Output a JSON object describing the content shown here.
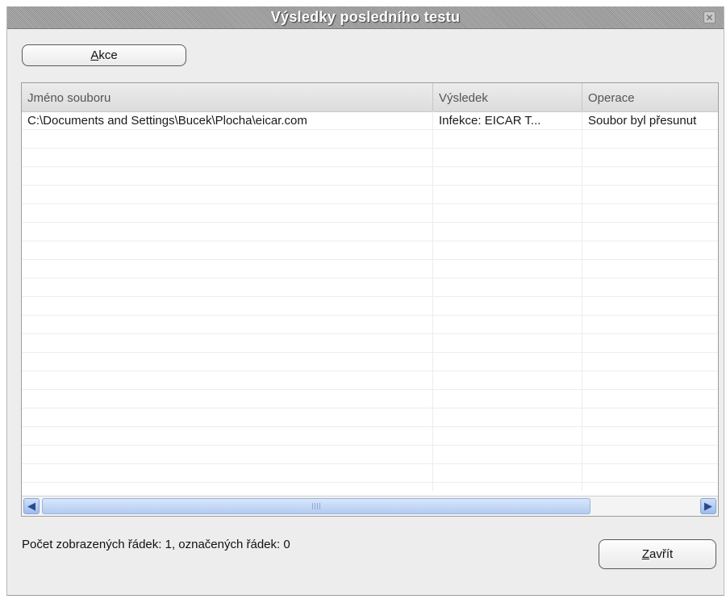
{
  "window": {
    "title": "Výsledky posledního testu",
    "close_glyph": "✕"
  },
  "toolbar": {
    "akce_label_accel": "A",
    "akce_label_rest": "kce"
  },
  "table": {
    "columns": [
      {
        "label": "Jméno souboru"
      },
      {
        "label": "Výsledek"
      },
      {
        "label": "Operace"
      }
    ],
    "rows": [
      {
        "file": "C:\\Documents and Settings\\Bucek\\Plocha\\eicar.com",
        "result": "Infekce: EICAR T...",
        "operation": "Soubor byl přesunut"
      }
    ]
  },
  "scrollbar": {
    "left_glyph": "◀",
    "right_glyph": "▶"
  },
  "status_text": "Počet zobrazených řádek: 1,  označených řádek: 0",
  "footer": {
    "close_label_accel": "Z",
    "close_label_rest": "avřít"
  }
}
